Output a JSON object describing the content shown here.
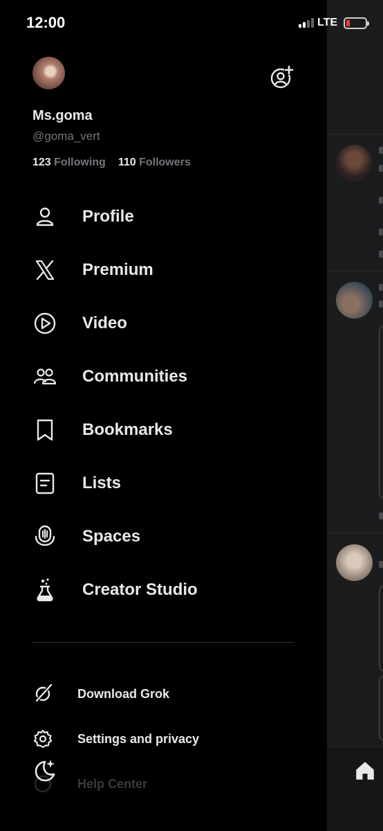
{
  "status_bar": {
    "time": "12:00",
    "network": "LTE"
  },
  "profile": {
    "name": "Ms.goma",
    "handle": "@goma_vert",
    "following_count": "123",
    "following_label": "Following",
    "followers_count": "110",
    "followers_label": "Followers"
  },
  "nav": {
    "items": [
      {
        "label": "Profile",
        "icon": "person-icon"
      },
      {
        "label": "Premium",
        "icon": "x-logo-icon"
      },
      {
        "label": "Video",
        "icon": "play-circle-icon"
      },
      {
        "label": "Communities",
        "icon": "people-icon"
      },
      {
        "label": "Bookmarks",
        "icon": "bookmark-icon"
      },
      {
        "label": "Lists",
        "icon": "list-icon"
      },
      {
        "label": "Spaces",
        "icon": "mic-icon"
      },
      {
        "label": "Creator Studio",
        "icon": "flask-icon"
      }
    ]
  },
  "secondary": {
    "items": [
      {
        "label": "Download Grok",
        "icon": "grok-icon"
      },
      {
        "label": "Settings and privacy",
        "icon": "gear-icon"
      },
      {
        "label": "Help Center",
        "icon": "help-icon"
      }
    ]
  },
  "colors": {
    "background": "#000000",
    "text": "#e7e9ea",
    "muted": "#71767b",
    "divider": "#2f3336",
    "battery_low": "#ff3b30"
  }
}
